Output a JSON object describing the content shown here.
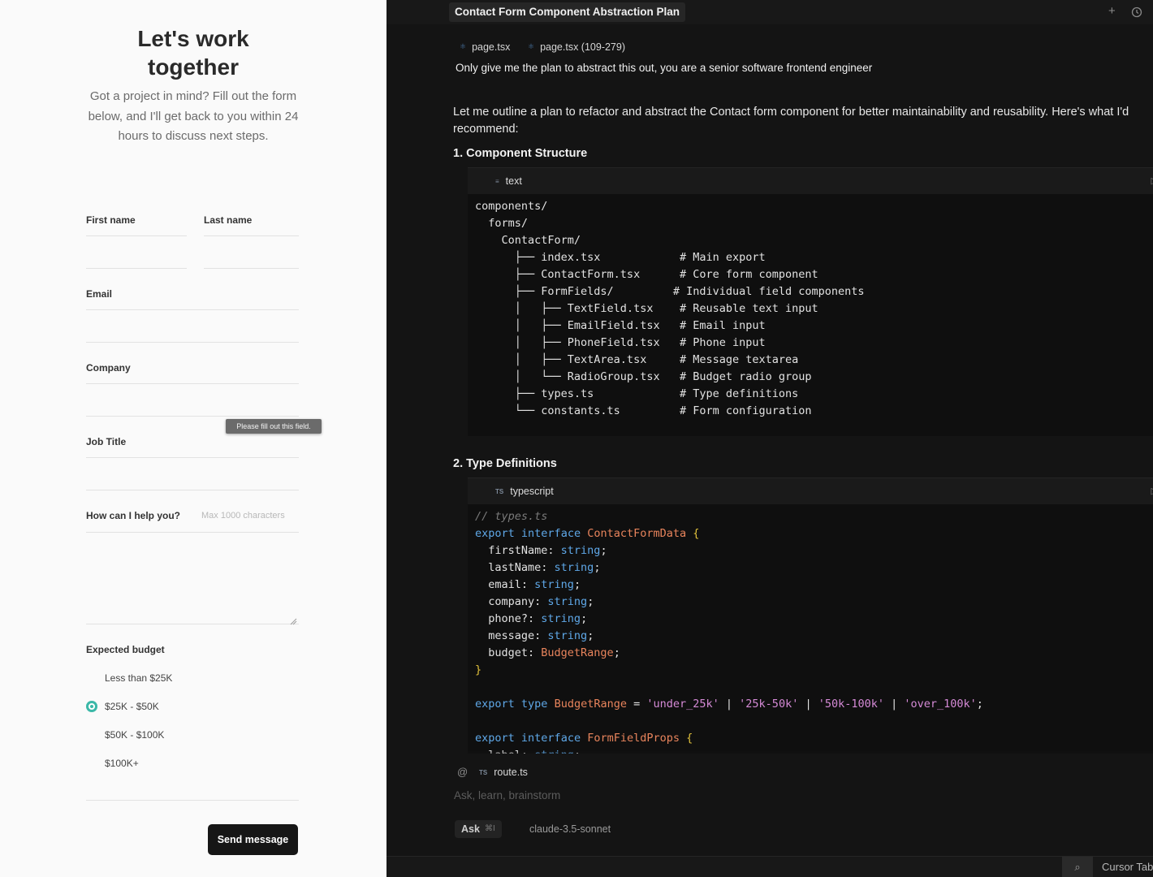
{
  "form": {
    "title": "Let's work\ntogether",
    "subtitle": "Got a project in mind? Fill out the form below, and I'll get back to you within 24 hours to discuss next steps.",
    "first_name_label": "First name",
    "last_name_label": "Last name",
    "email_label": "Email",
    "company_label": "Company",
    "job_title_label": "Job Title",
    "help_label": "How can I help you?",
    "help_placeholder": "Max 1000 characters",
    "validation_tooltip": "Please fill out this field.",
    "budget_label": "Expected budget",
    "budget_options": [
      "Less than $25K",
      "$25K - $50K",
      "$50K - $100K",
      "$100K+"
    ],
    "budget_selected": "$25K - $50K",
    "submit_label": "Send message",
    "accent_color": "#3bb8a8"
  },
  "chat": {
    "tab_title": "Contact Form Component Abstraction Plan",
    "top_icons": [
      "plus-icon",
      "history-icon"
    ],
    "context_files": [
      "page.tsx",
      "page.tsx (109-279)"
    ],
    "user_message": "Only give me the plan to abstract this out, you are a senior software frontend engineer",
    "response_intro": "Let me outline a plan to refactor and abstract the Contact form component for better maintainability and reusability. Here's what I'd recommend:",
    "sections": [
      {
        "heading": "1. Component Structure",
        "lang": "text",
        "lines": [
          "components/",
          "  forms/",
          "    ContactForm/",
          "      ├── index.tsx            # Main export",
          "      ├── ContactForm.tsx      # Core form component",
          "      ├── FormFields/         # Individual field components",
          "      │   ├── TextField.tsx    # Reusable text input",
          "      │   ├── EmailField.tsx   # Email input",
          "      │   ├── PhoneField.tsx   # Phone input",
          "      │   ├── TextArea.tsx     # Message textarea",
          "      │   └── RadioGroup.tsx   # Budget radio group",
          "      ├── types.ts             # Type definitions",
          "      └── constants.ts         # Form configuration"
        ]
      },
      {
        "heading": "2. Type Definitions",
        "lang": "typescript",
        "lines": [
          "// types.ts",
          "export interface ContactFormData {",
          "  firstName: string;",
          "  lastName: string;",
          "  email: string;",
          "  company: string;",
          "  phone?: string;",
          "  message: string;",
          "  budget: BudgetRange;",
          "}",
          "",
          "export type BudgetRange = 'under_25k' | '25k-50k' | '50k-100k' | 'over_100k';",
          "",
          "export interface FormFieldProps {",
          "  label: string;"
        ]
      }
    ],
    "input": {
      "mention_symbol": "@",
      "attached_file": "route.ts",
      "placeholder": "Ask, learn, brainstorm",
      "mode": "Ask",
      "mode_shortcut": "⌘I",
      "model": "claude-3.5-sonnet"
    },
    "status": {
      "cursor_tab": "Cursor Tab"
    }
  }
}
